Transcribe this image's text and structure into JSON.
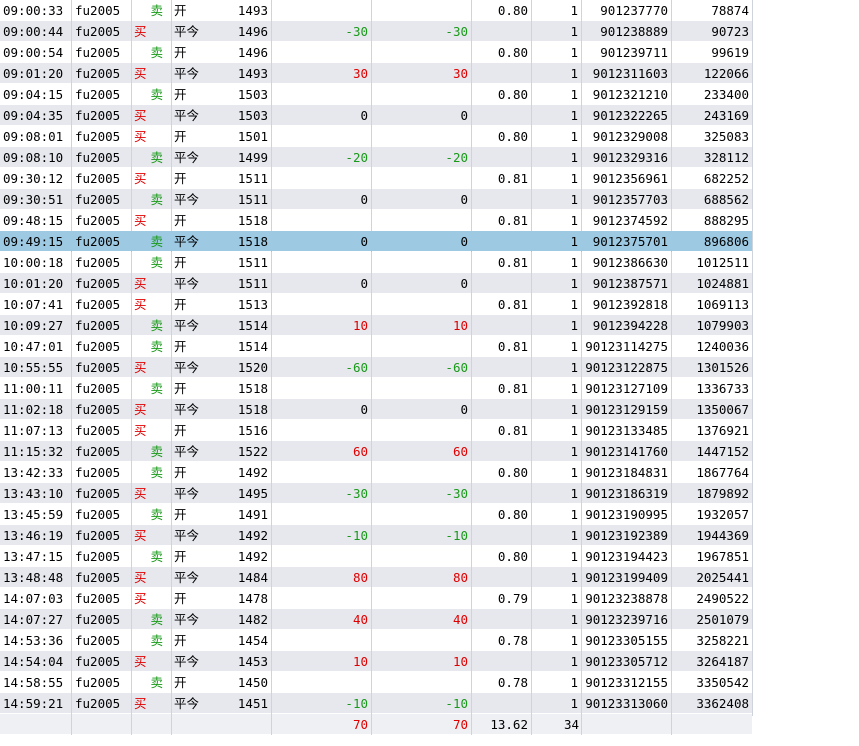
{
  "colors": {
    "sell": "#1a9a1a",
    "buy": "#e00000",
    "selected_row": "#9dc9e3",
    "alt_row": "#e6e8ee"
  },
  "selected_index": 11,
  "rows": [
    {
      "time": "09:00:33",
      "sym": "fu2005",
      "dir": "卖",
      "oc": "开",
      "price": "1493",
      "pnl1": "",
      "pnl2": "",
      "fee": "0.80",
      "qty": "1",
      "id": "901237770",
      "vol": "78874"
    },
    {
      "time": "09:00:44",
      "sym": "fu2005",
      "dir": "买",
      "oc": "平今",
      "price": "1496",
      "pnl1": "-30",
      "pnl2": "-30",
      "fee": "",
      "qty": "1",
      "id": "901238889",
      "vol": "90723"
    },
    {
      "time": "09:00:54",
      "sym": "fu2005",
      "dir": "卖",
      "oc": "开",
      "price": "1496",
      "pnl1": "",
      "pnl2": "",
      "fee": "0.80",
      "qty": "1",
      "id": "901239711",
      "vol": "99619"
    },
    {
      "time": "09:01:20",
      "sym": "fu2005",
      "dir": "买",
      "oc": "平今",
      "price": "1493",
      "pnl1": "30",
      "pnl2": "30",
      "fee": "",
      "qty": "1",
      "id": "9012311603",
      "vol": "122066"
    },
    {
      "time": "09:04:15",
      "sym": "fu2005",
      "dir": "卖",
      "oc": "开",
      "price": "1503",
      "pnl1": "",
      "pnl2": "",
      "fee": "0.80",
      "qty": "1",
      "id": "9012321210",
      "vol": "233400"
    },
    {
      "time": "09:04:35",
      "sym": "fu2005",
      "dir": "买",
      "oc": "平今",
      "price": "1503",
      "pnl1": "0",
      "pnl2": "0",
      "fee": "",
      "qty": "1",
      "id": "9012322265",
      "vol": "243169"
    },
    {
      "time": "09:08:01",
      "sym": "fu2005",
      "dir": "买",
      "oc": "开",
      "price": "1501",
      "pnl1": "",
      "pnl2": "",
      "fee": "0.80",
      "qty": "1",
      "id": "9012329008",
      "vol": "325083"
    },
    {
      "time": "09:08:10",
      "sym": "fu2005",
      "dir": "卖",
      "oc": "平今",
      "price": "1499",
      "pnl1": "-20",
      "pnl2": "-20",
      "fee": "",
      "qty": "1",
      "id": "9012329316",
      "vol": "328112"
    },
    {
      "time": "09:30:12",
      "sym": "fu2005",
      "dir": "买",
      "oc": "开",
      "price": "1511",
      "pnl1": "",
      "pnl2": "",
      "fee": "0.81",
      "qty": "1",
      "id": "9012356961",
      "vol": "682252"
    },
    {
      "time": "09:30:51",
      "sym": "fu2005",
      "dir": "卖",
      "oc": "平今",
      "price": "1511",
      "pnl1": "0",
      "pnl2": "0",
      "fee": "",
      "qty": "1",
      "id": "9012357703",
      "vol": "688562"
    },
    {
      "time": "09:48:15",
      "sym": "fu2005",
      "dir": "买",
      "oc": "开",
      "price": "1518",
      "pnl1": "",
      "pnl2": "",
      "fee": "0.81",
      "qty": "1",
      "id": "9012374592",
      "vol": "888295"
    },
    {
      "time": "09:49:15",
      "sym": "fu2005",
      "dir": "卖",
      "oc": "平今",
      "price": "1518",
      "pnl1": "0",
      "pnl2": "0",
      "fee": "",
      "qty": "1",
      "id": "9012375701",
      "vol": "896806"
    },
    {
      "time": "10:00:18",
      "sym": "fu2005",
      "dir": "卖",
      "oc": "开",
      "price": "1511",
      "pnl1": "",
      "pnl2": "",
      "fee": "0.81",
      "qty": "1",
      "id": "9012386630",
      "vol": "1012511"
    },
    {
      "time": "10:01:20",
      "sym": "fu2005",
      "dir": "买",
      "oc": "平今",
      "price": "1511",
      "pnl1": "0",
      "pnl2": "0",
      "fee": "",
      "qty": "1",
      "id": "9012387571",
      "vol": "1024881"
    },
    {
      "time": "10:07:41",
      "sym": "fu2005",
      "dir": "买",
      "oc": "开",
      "price": "1513",
      "pnl1": "",
      "pnl2": "",
      "fee": "0.81",
      "qty": "1",
      "id": "9012392818",
      "vol": "1069113"
    },
    {
      "time": "10:09:27",
      "sym": "fu2005",
      "dir": "卖",
      "oc": "平今",
      "price": "1514",
      "pnl1": "10",
      "pnl2": "10",
      "fee": "",
      "qty": "1",
      "id": "9012394228",
      "vol": "1079903"
    },
    {
      "time": "10:47:01",
      "sym": "fu2005",
      "dir": "卖",
      "oc": "开",
      "price": "1514",
      "pnl1": "",
      "pnl2": "",
      "fee": "0.81",
      "qty": "1",
      "id": "90123114275",
      "vol": "1240036"
    },
    {
      "time": "10:55:55",
      "sym": "fu2005",
      "dir": "买",
      "oc": "平今",
      "price": "1520",
      "pnl1": "-60",
      "pnl2": "-60",
      "fee": "",
      "qty": "1",
      "id": "90123122875",
      "vol": "1301526"
    },
    {
      "time": "11:00:11",
      "sym": "fu2005",
      "dir": "卖",
      "oc": "开",
      "price": "1518",
      "pnl1": "",
      "pnl2": "",
      "fee": "0.81",
      "qty": "1",
      "id": "90123127109",
      "vol": "1336733"
    },
    {
      "time": "11:02:18",
      "sym": "fu2005",
      "dir": "买",
      "oc": "平今",
      "price": "1518",
      "pnl1": "0",
      "pnl2": "0",
      "fee": "",
      "qty": "1",
      "id": "90123129159",
      "vol": "1350067"
    },
    {
      "time": "11:07:13",
      "sym": "fu2005",
      "dir": "买",
      "oc": "开",
      "price": "1516",
      "pnl1": "",
      "pnl2": "",
      "fee": "0.81",
      "qty": "1",
      "id": "90123133485",
      "vol": "1376921"
    },
    {
      "time": "11:15:32",
      "sym": "fu2005",
      "dir": "卖",
      "oc": "平今",
      "price": "1522",
      "pnl1": "60",
      "pnl2": "60",
      "fee": "",
      "qty": "1",
      "id": "90123141760",
      "vol": "1447152"
    },
    {
      "time": "13:42:33",
      "sym": "fu2005",
      "dir": "卖",
      "oc": "开",
      "price": "1492",
      "pnl1": "",
      "pnl2": "",
      "fee": "0.80",
      "qty": "1",
      "id": "90123184831",
      "vol": "1867764"
    },
    {
      "time": "13:43:10",
      "sym": "fu2005",
      "dir": "买",
      "oc": "平今",
      "price": "1495",
      "pnl1": "-30",
      "pnl2": "-30",
      "fee": "",
      "qty": "1",
      "id": "90123186319",
      "vol": "1879892"
    },
    {
      "time": "13:45:59",
      "sym": "fu2005",
      "dir": "卖",
      "oc": "开",
      "price": "1491",
      "pnl1": "",
      "pnl2": "",
      "fee": "0.80",
      "qty": "1",
      "id": "90123190995",
      "vol": "1932057"
    },
    {
      "time": "13:46:19",
      "sym": "fu2005",
      "dir": "买",
      "oc": "平今",
      "price": "1492",
      "pnl1": "-10",
      "pnl2": "-10",
      "fee": "",
      "qty": "1",
      "id": "90123192389",
      "vol": "1944369"
    },
    {
      "time": "13:47:15",
      "sym": "fu2005",
      "dir": "卖",
      "oc": "开",
      "price": "1492",
      "pnl1": "",
      "pnl2": "",
      "fee": "0.80",
      "qty": "1",
      "id": "90123194423",
      "vol": "1967851"
    },
    {
      "time": "13:48:48",
      "sym": "fu2005",
      "dir": "买",
      "oc": "平今",
      "price": "1484",
      "pnl1": "80",
      "pnl2": "80",
      "fee": "",
      "qty": "1",
      "id": "90123199409",
      "vol": "2025441"
    },
    {
      "time": "14:07:03",
      "sym": "fu2005",
      "dir": "买",
      "oc": "开",
      "price": "1478",
      "pnl1": "",
      "pnl2": "",
      "fee": "0.79",
      "qty": "1",
      "id": "90123238878",
      "vol": "2490522"
    },
    {
      "time": "14:07:27",
      "sym": "fu2005",
      "dir": "卖",
      "oc": "平今",
      "price": "1482",
      "pnl1": "40",
      "pnl2": "40",
      "fee": "",
      "qty": "1",
      "id": "90123239716",
      "vol": "2501079"
    },
    {
      "time": "14:53:36",
      "sym": "fu2005",
      "dir": "卖",
      "oc": "开",
      "price": "1454",
      "pnl1": "",
      "pnl2": "",
      "fee": "0.78",
      "qty": "1",
      "id": "90123305155",
      "vol": "3258221"
    },
    {
      "time": "14:54:04",
      "sym": "fu2005",
      "dir": "买",
      "oc": "平今",
      "price": "1453",
      "pnl1": "10",
      "pnl2": "10",
      "fee": "",
      "qty": "1",
      "id": "90123305712",
      "vol": "3264187"
    },
    {
      "time": "14:58:55",
      "sym": "fu2005",
      "dir": "卖",
      "oc": "开",
      "price": "1450",
      "pnl1": "",
      "pnl2": "",
      "fee": "0.78",
      "qty": "1",
      "id": "90123312155",
      "vol": "3350542"
    },
    {
      "time": "14:59:21",
      "sym": "fu2005",
      "dir": "买",
      "oc": "平今",
      "price": "1451",
      "pnl1": "-10",
      "pnl2": "-10",
      "fee": "",
      "qty": "1",
      "id": "90123313060",
      "vol": "3362408"
    }
  ],
  "totals": {
    "pnl1": "70",
    "pnl2": "70",
    "fee": "13.62",
    "qty": "34"
  }
}
